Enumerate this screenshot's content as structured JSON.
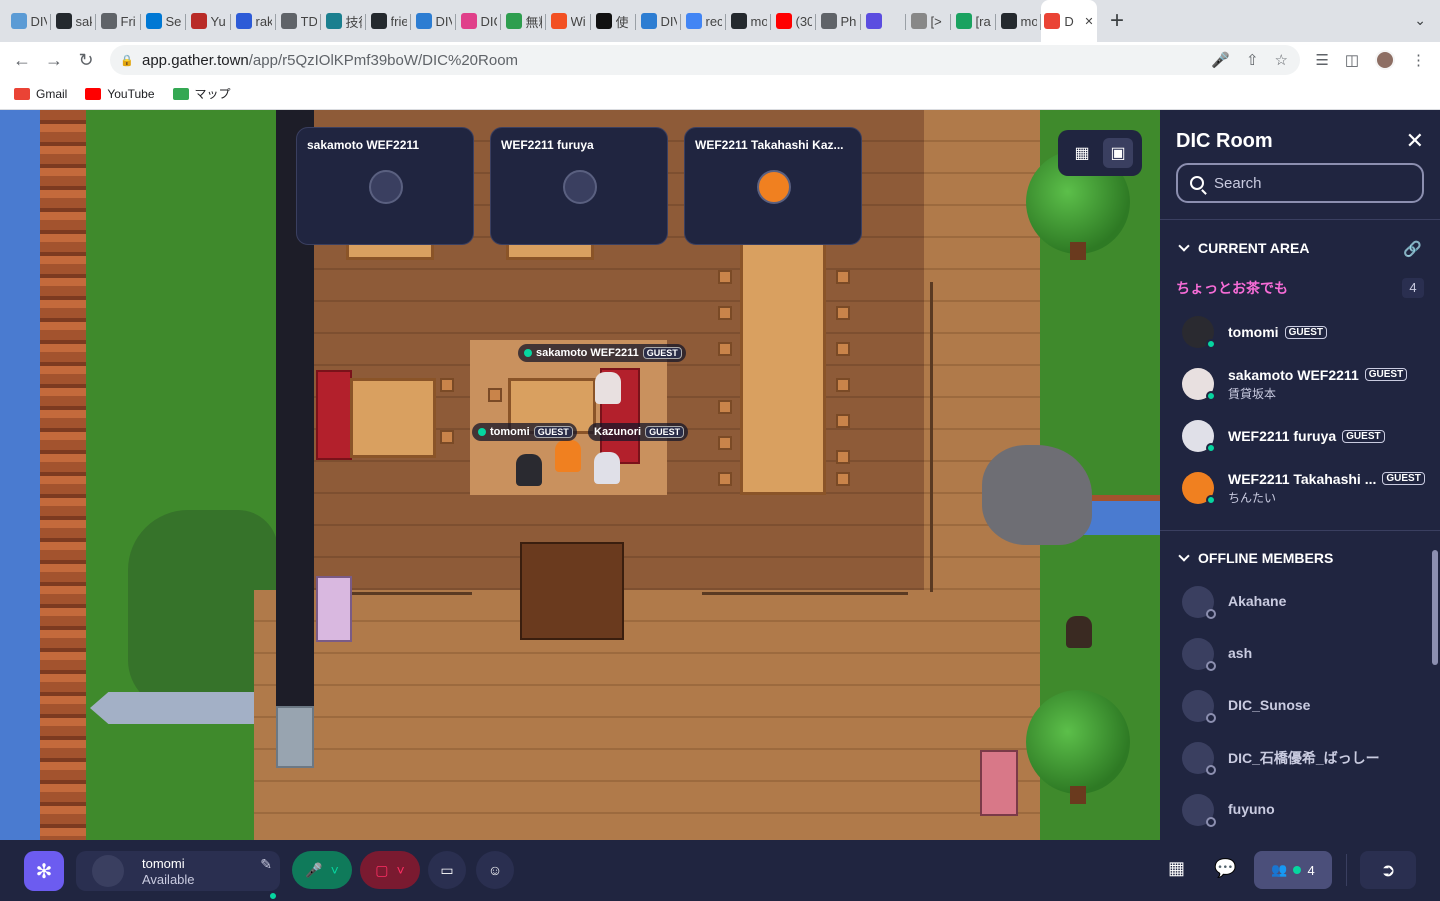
{
  "browser": {
    "tabs": [
      {
        "title": "DIV",
        "icon": "globe-icon",
        "color": "#5b9bd5"
      },
      {
        "title": "sak",
        "icon": "github-icon",
        "color": "#24292e"
      },
      {
        "title": "Fri",
        "icon": "globe-icon",
        "color": "#5f6368"
      },
      {
        "title": "Ser",
        "icon": "app-icon",
        "color": "#0078d4"
      },
      {
        "title": "Yu",
        "icon": "quora-icon",
        "color": "#b92b27"
      },
      {
        "title": "rak",
        "icon": "linear-icon",
        "color": "#2d5bd7"
      },
      {
        "title": "TD",
        "icon": "globe-icon",
        "color": "#5f6368"
      },
      {
        "title": "技術",
        "icon": "app-icon",
        "color": "#1b7f8f"
      },
      {
        "title": "frie",
        "icon": "github-icon",
        "color": "#24292e"
      },
      {
        "title": "DIV",
        "icon": "globe-icon",
        "color": "#2d7dd2"
      },
      {
        "title": "DIC",
        "icon": "heart-icon",
        "color": "#e0408a"
      },
      {
        "title": "無料",
        "icon": "app-icon",
        "color": "#2e9e4f"
      },
      {
        "title": "Wi",
        "icon": "windows-icon",
        "color": "#f25022"
      },
      {
        "title": "使",
        "icon": "notion-icon",
        "color": "#111111"
      },
      {
        "title": "DIV",
        "icon": "globe-icon",
        "color": "#2d7dd2"
      },
      {
        "title": "rec",
        "icon": "google-icon",
        "color": "#4285f4"
      },
      {
        "title": "mo",
        "icon": "github-icon",
        "color": "#24292e"
      },
      {
        "title": "(30",
        "icon": "youtube-icon",
        "color": "#ff0000"
      },
      {
        "title": "Ph",
        "icon": "globe-icon",
        "color": "#5f6368"
      },
      {
        "title": "",
        "icon": "app-icon",
        "color": "#5b4de0"
      },
      {
        "title": "[>",
        "icon": "app-icon",
        "color": "#888888"
      },
      {
        "title": "[ra",
        "icon": "app-icon",
        "color": "#1aa260"
      },
      {
        "title": "mo",
        "icon": "github-icon",
        "color": "#24292e"
      },
      {
        "title": "D",
        "icon": "recording-icon",
        "color": "#ea4335",
        "active": true
      }
    ],
    "url_host": "app.gather.town",
    "url_path": "/app/r5QzIOlKPmf39boW/DIC%20Room",
    "bookmarks": [
      {
        "label": "Gmail",
        "icon": "gmail-icon",
        "color": "#ea4335"
      },
      {
        "label": "YouTube",
        "icon": "youtube-icon",
        "color": "#ff0000"
      },
      {
        "label": "マップ",
        "icon": "maps-icon",
        "color": "#34a853"
      }
    ]
  },
  "map": {
    "video_tiles": [
      {
        "name": "sakamoto WEF2211"
      },
      {
        "name": "WEF2211 furuya"
      },
      {
        "name": "WEF2211 Takahashi Kaz..."
      }
    ],
    "nametags": [
      {
        "name": "sakamoto WEF2211",
        "badge": "GUEST"
      },
      {
        "name": "tomomi",
        "badge": "GUEST"
      },
      {
        "name": "Kazunori",
        "badge": "GUEST"
      }
    ]
  },
  "sidebar": {
    "title": "DIC Room",
    "search_placeholder": "Search",
    "current_area_label": "CURRENT AREA",
    "area_name": "ちょっとお茶でも",
    "area_count": "4",
    "current_members": [
      {
        "name": "tomomi",
        "badge": "GUEST",
        "sub": ""
      },
      {
        "name": "sakamoto WEF2211",
        "badge": "GUEST",
        "sub": "賃貸坂本"
      },
      {
        "name": "WEF2211 furuya",
        "badge": "GUEST",
        "sub": ""
      },
      {
        "name": "WEF2211 Takahashi ...",
        "badge": "GUEST",
        "sub": "ちんたい"
      }
    ],
    "offline_label": "OFFLINE MEMBERS",
    "offline_members": [
      {
        "name": "Akahane"
      },
      {
        "name": "ash"
      },
      {
        "name": "DIC_Sunose"
      },
      {
        "name": "DIC_石橋優希_ばっしー"
      },
      {
        "name": "fuyuno"
      }
    ]
  },
  "bottombar": {
    "user_name": "tomomi",
    "user_status": "Available",
    "participant_count": "4"
  },
  "colors": {
    "gather_bg": "#202540",
    "accent_purple": "#6c5cf0",
    "online_green": "#06d6a0",
    "area_pink": "#f76cd7",
    "mic_green": "#0f7a5a",
    "cam_red": "#7a1a30"
  }
}
